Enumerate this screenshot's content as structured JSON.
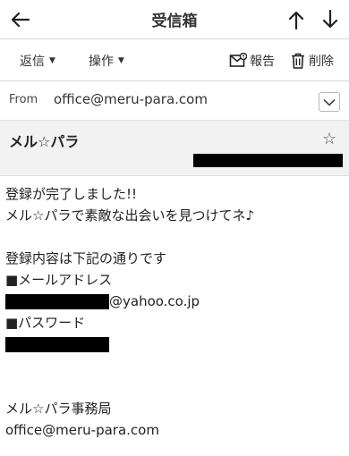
{
  "header": {
    "title": "受信箱",
    "back_icon": "arrow-left-icon",
    "up_icon": "arrow-up-icon",
    "down_icon": "arrow-down-icon"
  },
  "toolbar": {
    "reply_label": "返信",
    "operations_label": "操作",
    "report_label": "報告",
    "delete_label": "削除",
    "caret": "▼"
  },
  "from": {
    "label": "From",
    "address": "office@meru-para.com"
  },
  "subject": {
    "sender": "メル☆パラ",
    "star": "☆"
  },
  "body": {
    "line1": "登録が完了しました!!",
    "line2": "メル☆パラで素敵な出会いを見つけてネ♪",
    "line3": "登録内容は下記の通りです",
    "line4": "■メールアドレス",
    "line5_suffix": "@yahoo.co.jp",
    "line6": "■パスワード",
    "line7": "メル☆パラ事務局",
    "line8": "office@meru-para.com"
  }
}
